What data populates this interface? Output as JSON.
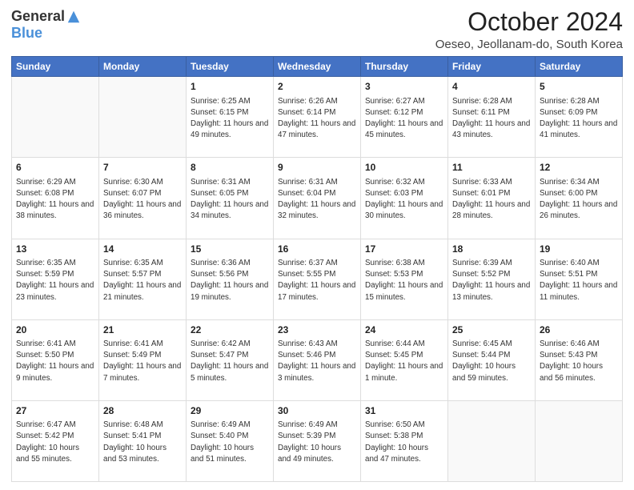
{
  "logo": {
    "general": "General",
    "blue": "Blue"
  },
  "header": {
    "title": "October 2024",
    "subtitle": "Oeseo, Jeollanam-do, South Korea"
  },
  "weekdays": [
    "Sunday",
    "Monday",
    "Tuesday",
    "Wednesday",
    "Thursday",
    "Friday",
    "Saturday"
  ],
  "weeks": [
    [
      {
        "day": "",
        "info": ""
      },
      {
        "day": "",
        "info": ""
      },
      {
        "day": "1",
        "info": "Sunrise: 6:25 AM\nSunset: 6:15 PM\nDaylight: 11 hours\nand 49 minutes."
      },
      {
        "day": "2",
        "info": "Sunrise: 6:26 AM\nSunset: 6:14 PM\nDaylight: 11 hours\nand 47 minutes."
      },
      {
        "day": "3",
        "info": "Sunrise: 6:27 AM\nSunset: 6:12 PM\nDaylight: 11 hours\nand 45 minutes."
      },
      {
        "day": "4",
        "info": "Sunrise: 6:28 AM\nSunset: 6:11 PM\nDaylight: 11 hours\nand 43 minutes."
      },
      {
        "day": "5",
        "info": "Sunrise: 6:28 AM\nSunset: 6:09 PM\nDaylight: 11 hours\nand 41 minutes."
      }
    ],
    [
      {
        "day": "6",
        "info": "Sunrise: 6:29 AM\nSunset: 6:08 PM\nDaylight: 11 hours\nand 38 minutes."
      },
      {
        "day": "7",
        "info": "Sunrise: 6:30 AM\nSunset: 6:07 PM\nDaylight: 11 hours\nand 36 minutes."
      },
      {
        "day": "8",
        "info": "Sunrise: 6:31 AM\nSunset: 6:05 PM\nDaylight: 11 hours\nand 34 minutes."
      },
      {
        "day": "9",
        "info": "Sunrise: 6:31 AM\nSunset: 6:04 PM\nDaylight: 11 hours\nand 32 minutes."
      },
      {
        "day": "10",
        "info": "Sunrise: 6:32 AM\nSunset: 6:03 PM\nDaylight: 11 hours\nand 30 minutes."
      },
      {
        "day": "11",
        "info": "Sunrise: 6:33 AM\nSunset: 6:01 PM\nDaylight: 11 hours\nand 28 minutes."
      },
      {
        "day": "12",
        "info": "Sunrise: 6:34 AM\nSunset: 6:00 PM\nDaylight: 11 hours\nand 26 minutes."
      }
    ],
    [
      {
        "day": "13",
        "info": "Sunrise: 6:35 AM\nSunset: 5:59 PM\nDaylight: 11 hours\nand 23 minutes."
      },
      {
        "day": "14",
        "info": "Sunrise: 6:35 AM\nSunset: 5:57 PM\nDaylight: 11 hours\nand 21 minutes."
      },
      {
        "day": "15",
        "info": "Sunrise: 6:36 AM\nSunset: 5:56 PM\nDaylight: 11 hours\nand 19 minutes."
      },
      {
        "day": "16",
        "info": "Sunrise: 6:37 AM\nSunset: 5:55 PM\nDaylight: 11 hours\nand 17 minutes."
      },
      {
        "day": "17",
        "info": "Sunrise: 6:38 AM\nSunset: 5:53 PM\nDaylight: 11 hours\nand 15 minutes."
      },
      {
        "day": "18",
        "info": "Sunrise: 6:39 AM\nSunset: 5:52 PM\nDaylight: 11 hours\nand 13 minutes."
      },
      {
        "day": "19",
        "info": "Sunrise: 6:40 AM\nSunset: 5:51 PM\nDaylight: 11 hours\nand 11 minutes."
      }
    ],
    [
      {
        "day": "20",
        "info": "Sunrise: 6:41 AM\nSunset: 5:50 PM\nDaylight: 11 hours\nand 9 minutes."
      },
      {
        "day": "21",
        "info": "Sunrise: 6:41 AM\nSunset: 5:49 PM\nDaylight: 11 hours\nand 7 minutes."
      },
      {
        "day": "22",
        "info": "Sunrise: 6:42 AM\nSunset: 5:47 PM\nDaylight: 11 hours\nand 5 minutes."
      },
      {
        "day": "23",
        "info": "Sunrise: 6:43 AM\nSunset: 5:46 PM\nDaylight: 11 hours\nand 3 minutes."
      },
      {
        "day": "24",
        "info": "Sunrise: 6:44 AM\nSunset: 5:45 PM\nDaylight: 11 hours\nand 1 minute."
      },
      {
        "day": "25",
        "info": "Sunrise: 6:45 AM\nSunset: 5:44 PM\nDaylight: 10 hours\nand 59 minutes."
      },
      {
        "day": "26",
        "info": "Sunrise: 6:46 AM\nSunset: 5:43 PM\nDaylight: 10 hours\nand 56 minutes."
      }
    ],
    [
      {
        "day": "27",
        "info": "Sunrise: 6:47 AM\nSunset: 5:42 PM\nDaylight: 10 hours\nand 55 minutes."
      },
      {
        "day": "28",
        "info": "Sunrise: 6:48 AM\nSunset: 5:41 PM\nDaylight: 10 hours\nand 53 minutes."
      },
      {
        "day": "29",
        "info": "Sunrise: 6:49 AM\nSunset: 5:40 PM\nDaylight: 10 hours\nand 51 minutes."
      },
      {
        "day": "30",
        "info": "Sunrise: 6:49 AM\nSunset: 5:39 PM\nDaylight: 10 hours\nand 49 minutes."
      },
      {
        "day": "31",
        "info": "Sunrise: 6:50 AM\nSunset: 5:38 PM\nDaylight: 10 hours\nand 47 minutes."
      },
      {
        "day": "",
        "info": ""
      },
      {
        "day": "",
        "info": ""
      }
    ]
  ]
}
